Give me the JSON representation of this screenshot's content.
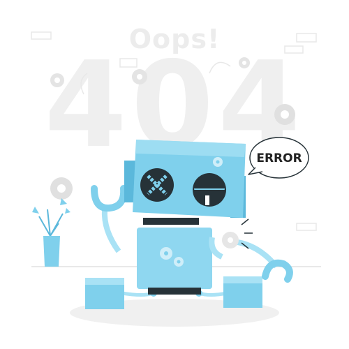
{
  "heading": "Oops!",
  "code": "404",
  "bubble": "ERROR",
  "colors": {
    "robot": "#7fd0ec",
    "robot_light": "#a9e2f5",
    "robot_dark": "#5bb8db",
    "outline": "#263238",
    "bg_shape": "#f1f1f1"
  },
  "icons": [
    "gear-icon",
    "speech-bubble-icon",
    "potted-plant-icon"
  ]
}
